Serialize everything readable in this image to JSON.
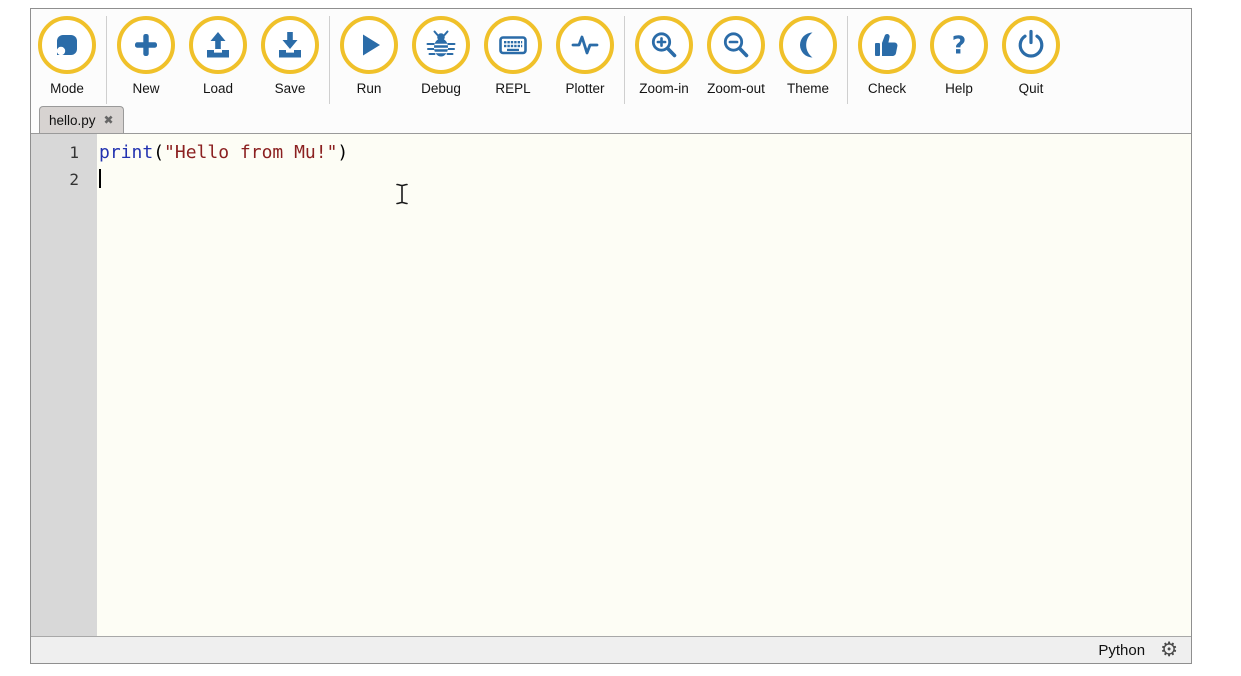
{
  "toolbar": {
    "buttons": [
      {
        "label": "Mode",
        "icon": "mode-icon"
      },
      {
        "label": "New",
        "icon": "new-icon"
      },
      {
        "label": "Load",
        "icon": "load-icon"
      },
      {
        "label": "Save",
        "icon": "save-icon"
      },
      {
        "label": "Run",
        "icon": "run-icon"
      },
      {
        "label": "Debug",
        "icon": "debug-icon"
      },
      {
        "label": "REPL",
        "icon": "repl-icon"
      },
      {
        "label": "Plotter",
        "icon": "plotter-icon"
      },
      {
        "label": "Zoom-in",
        "icon": "zoom-in-icon"
      },
      {
        "label": "Zoom-out",
        "icon": "zoom-out-icon"
      },
      {
        "label": "Theme",
        "icon": "theme-icon"
      },
      {
        "label": "Check",
        "icon": "check-icon"
      },
      {
        "label": "Help",
        "icon": "help-icon"
      },
      {
        "label": "Quit",
        "icon": "quit-icon"
      }
    ]
  },
  "tabs": [
    {
      "label": "hello.py",
      "close_glyph": "✖",
      "active": true
    }
  ],
  "editor": {
    "lines": [
      {
        "number": "1",
        "tokens": [
          {
            "text": "print",
            "type": "builtin"
          },
          {
            "text": "(",
            "type": "plain"
          },
          {
            "text": "\"Hello from Mu!\"",
            "type": "string"
          },
          {
            "text": ")",
            "type": "plain"
          }
        ]
      },
      {
        "number": "2",
        "tokens": []
      }
    ]
  },
  "statusbar": {
    "mode_label": "Python",
    "gear_glyph": "⚙"
  },
  "colors": {
    "icon_blue": "#2B6CA8",
    "ring_gold": "#F0C12A",
    "builtin_blue": "#2333B0",
    "string_red": "#8B2020",
    "editor_bg": "#fdfdf5",
    "gutter_bg": "#d8d8d8"
  }
}
